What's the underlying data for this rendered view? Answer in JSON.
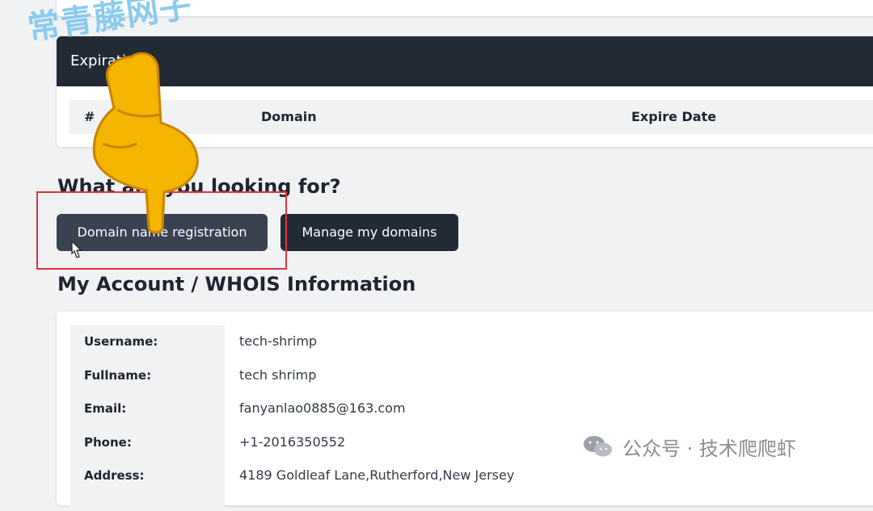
{
  "watermark": "常青藤网子",
  "expire_section": {
    "header": "Expiration:",
    "columns": [
      "#",
      "Domain",
      "Expire Date"
    ]
  },
  "looking_for": {
    "title": "What are you looking for?",
    "buttons": [
      "Domain name registration",
      "Manage my domains"
    ]
  },
  "account": {
    "title": "My Account / WHOIS Information",
    "fields": [
      {
        "label": "Username:",
        "value": "tech-shrimp"
      },
      {
        "label": "Fullname:",
        "value": "tech shrimp"
      },
      {
        "label": "Email:",
        "value": "fanyanlao0885@163.com"
      },
      {
        "label": "Phone:",
        "value": "+1-2016350552"
      },
      {
        "label": "Address:",
        "value": "4189 Goldleaf Lane,Rutherford,New Jersey"
      }
    ]
  },
  "footer_badge": "公众号 · 技术爬爬虾",
  "colors": {
    "dark": "#222a35",
    "button_hover": "#3a4150",
    "highlight": "#e0353b",
    "watermark": "#7fc7ee"
  }
}
